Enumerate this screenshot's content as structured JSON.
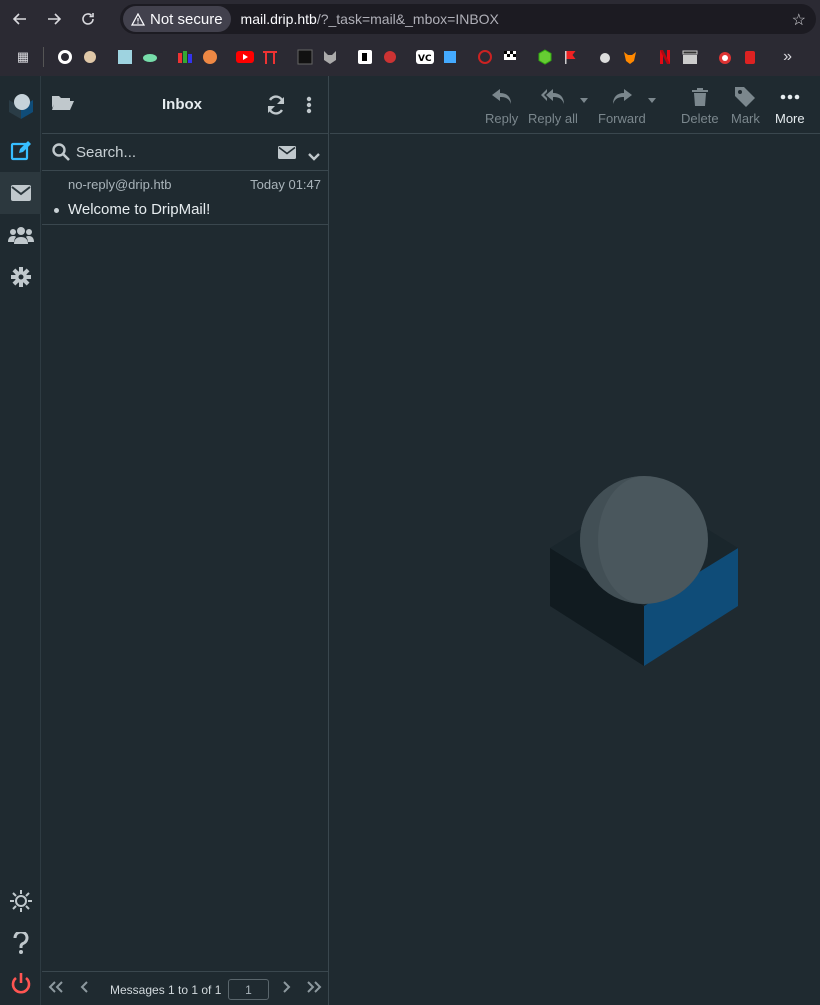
{
  "browser": {
    "security_label": "Not secure",
    "url_host": "mail.drip.htb",
    "url_path": "/?_task=mail&_mbox=INBOX"
  },
  "folder": {
    "title": "Inbox"
  },
  "search": {
    "placeholder": "Search..."
  },
  "messages": [
    {
      "from": "no-reply@drip.htb",
      "date": "Today 01:47",
      "subject": "Welcome to DripMail!"
    }
  ],
  "pagination": {
    "text": "Messages 1 to 1 of 1",
    "page": "1"
  },
  "toolbar": {
    "reply": "Reply",
    "reply_all": "Reply all",
    "forward": "Forward",
    "delete": "Delete",
    "mark": "Mark",
    "more": "More"
  },
  "colors": {
    "accent": "#37beff",
    "background": "#1f2a30",
    "logout": "#ff5552",
    "logo_blue": "#0f4c78"
  }
}
